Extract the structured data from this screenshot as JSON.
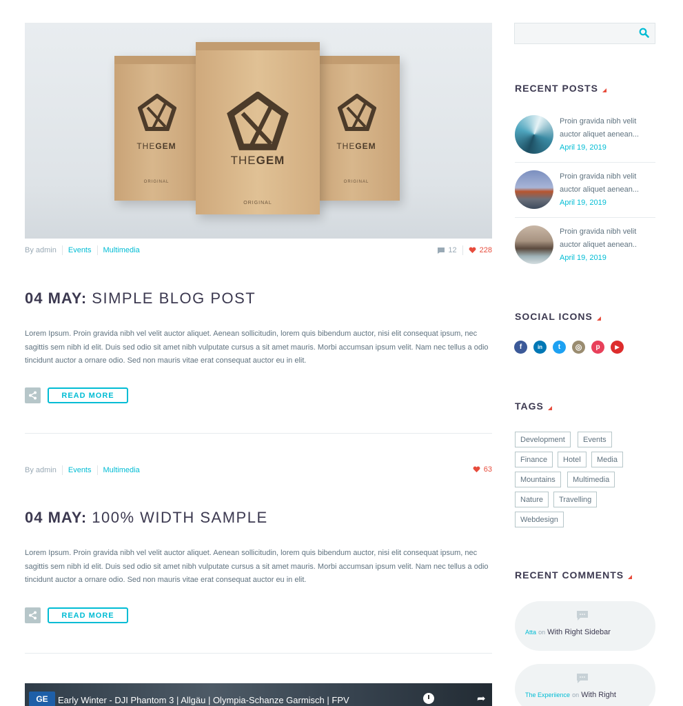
{
  "posts": [
    {
      "author": "By admin",
      "categories": [
        "Events",
        "Multimedia"
      ],
      "comments": "12",
      "likes": "228",
      "date": "04 MAY:",
      "title": "SIMPLE BLOG POST",
      "excerpt": "Lorem Ipsum. Proin gravida nibh vel velit auctor aliquet. Aenean sollicitudin, lorem quis bibendum auctor, nisi elit consequat ipsum, nec sagittis sem nibh id elit. Duis sed odio sit amet nibh vulputate cursus a sit amet mauris. Morbi accumsan ipsum velit. Nam nec tellus a odio tincidunt auctor a ornare odio. Sed non mauris vitae erat consequat auctor eu in elit.",
      "read_more": "READ MORE",
      "image": {
        "brand_light": "THE",
        "brand_bold": "GEM",
        "label": "ORIGINAL"
      }
    },
    {
      "author": "By admin",
      "categories": [
        "Events",
        "Multimedia"
      ],
      "likes": "63",
      "date": "04 MAY:",
      "title": "100% WIDTH SAMPLE",
      "excerpt": "Lorem Ipsum. Proin gravida nibh vel velit auctor aliquet. Aenean sollicitudin, lorem quis bibendum auctor, nisi elit consequat ipsum, nec sagittis sem nibh id elit. Duis sed odio sit amet nibh vulputate cursus a sit amet mauris. Morbi accumsan ipsum velit. Nam nec tellus a odio tincidunt auctor a ornare odio. Sed non mauris vitae erat consequat auctor eu in elit.",
      "read_more": "READ MORE"
    }
  ],
  "video": {
    "channel_logo": "GE",
    "title": "Early Winter - DJI Phantom 3 | Allgäu | Olympia-Schanze Garmisch | FPV"
  },
  "sidebar": {
    "search": {
      "placeholder": "",
      "icon": "search-icon"
    },
    "recent_posts": {
      "title": "RECENT POSTS",
      "items": [
        {
          "text": "Proin gravida nibh velit auctor aliquet aenean...",
          "date": "April 19, 2019"
        },
        {
          "text": "Proin gravida nibh velit auctor aliquet aenean...",
          "date": "April 19, 2019"
        },
        {
          "text": "Proin gravida nibh velit auctor aliquet aenean..",
          "date": "April 19, 2019"
        }
      ]
    },
    "social_icons": {
      "title": "SOCIAL ICONS",
      "items": [
        {
          "name": "facebook-icon",
          "glyph": "f",
          "color": "#3b5998"
        },
        {
          "name": "linkedin-icon",
          "glyph": "in",
          "color": "#0077b5"
        },
        {
          "name": "twitter-icon",
          "glyph": "t",
          "color": "#1da1f2"
        },
        {
          "name": "instagram-icon",
          "glyph": "◎",
          "color": "#9a8c70"
        },
        {
          "name": "pinterest-icon",
          "glyph": "p",
          "color": "#e8405a"
        },
        {
          "name": "youtube-icon",
          "glyph": "▶",
          "color": "#dd2c2c"
        }
      ]
    },
    "tags": {
      "title": "TAGS",
      "items": [
        "Development",
        "Events",
        "Finance",
        "Hotel",
        "Media",
        "Mountains",
        "Multimedia",
        "Nature",
        "Travelling",
        "Webdesign"
      ]
    },
    "recent_comments": {
      "title": "RECENT COMMENTS",
      "items": [
        {
          "author": "Atta",
          "on": "on",
          "post": "With Right Sidebar"
        },
        {
          "author": "The Experiience",
          "on": "on",
          "post": "With Right"
        }
      ]
    }
  },
  "colors": {
    "accent": "#00bcd4",
    "heading": "#3c3950",
    "like": "#e74c3c",
    "body_text": "#5f727f"
  }
}
